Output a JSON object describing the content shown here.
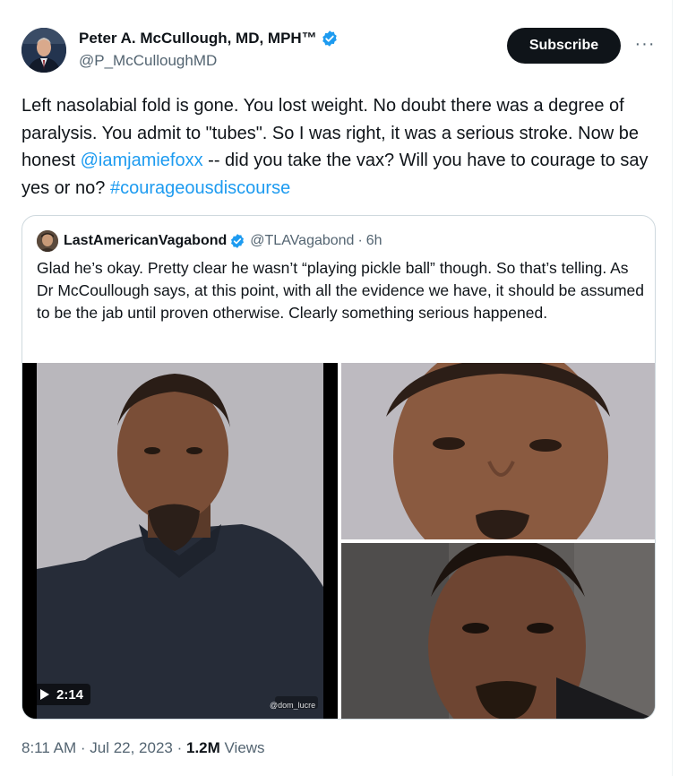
{
  "author": {
    "display_name": "Peter A. McCullough, MD, MPH™",
    "handle": "@P_McCulloughMD",
    "verified": true
  },
  "actions": {
    "subscribe_label": "Subscribe",
    "more_label": "···"
  },
  "tweet": {
    "text_1": "Left nasolabial fold is gone.  You lost weight.  No doubt there was a degree of paralysis.  You admit to \"tubes\".  So I was right, it was a serious stroke.  Now be honest ",
    "mention": "@iamjamiefoxx",
    "text_2": " -- did you take the vax?  Will you have to courage to say yes or no?  ",
    "hashtag": "#courageousdiscourse"
  },
  "quoted": {
    "display_name": "LastAmericanVagabond",
    "handle": "@TLAVagabond",
    "separator": "·",
    "time": "6h",
    "text": "Glad he’s okay. Pretty clear he wasn’t “playing pickle ball” though. So that’s telling. As Dr McCoullough says, at this point, with all the evidence we have, it should be assumed to be the jab until proven otherwise. Clearly something serious happened.",
    "video_duration": "2:14",
    "watermark": "@dom_lucre"
  },
  "meta": {
    "time": "8:11 AM",
    "sep1": " · ",
    "date": "Jul 22, 2023",
    "sep2": " · ",
    "views_count": "1.2M",
    "views_label": " Views"
  },
  "colors": {
    "link": "#1d9bf0",
    "text": "#0f1419",
    "secondary": "#536471",
    "verified": "#1d9bf0"
  }
}
